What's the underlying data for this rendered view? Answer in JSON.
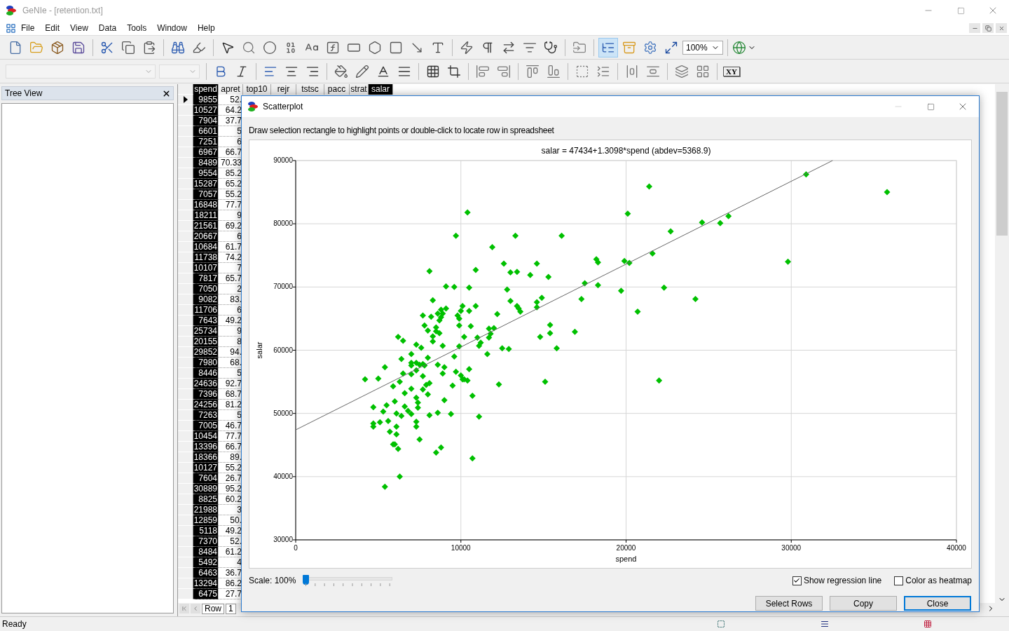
{
  "window": {
    "title": "GeNIe - [retention.txt]"
  },
  "menu": [
    "File",
    "Edit",
    "View",
    "Data",
    "Tools",
    "Window",
    "Help"
  ],
  "toolbar": {
    "tree_toggle": {
      "selected": true
    },
    "zoom": "100%",
    "xy_label": "XY"
  },
  "tree_view": {
    "title": "Tree View"
  },
  "grid": {
    "columns": [
      {
        "name": "spend",
        "selected": true
      },
      {
        "name": "apret",
        "selected": false
      },
      {
        "name": "top10",
        "selected": false
      },
      {
        "name": "rejr",
        "selected": false
      },
      {
        "name": "tstsc",
        "selected": false
      },
      {
        "name": "pacc",
        "selected": false
      },
      {
        "name": "strat",
        "selected": false
      },
      {
        "name": "salar",
        "selected": true
      }
    ],
    "rows": [
      [
        "9855",
        "52."
      ],
      [
        "10527",
        "64.2"
      ],
      [
        "7904",
        "37.7"
      ],
      [
        "6601",
        "5"
      ],
      [
        "7251",
        "6"
      ],
      [
        "6967",
        "66.7"
      ],
      [
        "8489",
        "70.33"
      ],
      [
        "9554",
        "85.2"
      ],
      [
        "15287",
        "65.2"
      ],
      [
        "7057",
        "55.2"
      ],
      [
        "16848",
        "77.7"
      ],
      [
        "18211",
        "9"
      ],
      [
        "21561",
        "69.2"
      ],
      [
        "20667",
        "6"
      ],
      [
        "10684",
        "61.7"
      ],
      [
        "11738",
        "74.2"
      ],
      [
        "10107",
        "7"
      ],
      [
        "7817",
        "65.7"
      ],
      [
        "7050",
        "2"
      ],
      [
        "9082",
        "83."
      ],
      [
        "11706",
        "6"
      ],
      [
        "7643",
        "49.2"
      ],
      [
        "25734",
        "9"
      ],
      [
        "20155",
        "8"
      ],
      [
        "29852",
        "94."
      ],
      [
        "7980",
        "68."
      ],
      [
        "8446",
        "5"
      ],
      [
        "24636",
        "92.7"
      ],
      [
        "7396",
        "68.7"
      ],
      [
        "24256",
        "81.2"
      ],
      [
        "7263",
        "5"
      ],
      [
        "7005",
        "46.7"
      ],
      [
        "10454",
        "77.7"
      ],
      [
        "13396",
        "66.7"
      ],
      [
        "18366",
        "89."
      ],
      [
        "10127",
        "55.2"
      ],
      [
        "7604",
        "26.7"
      ],
      [
        "30889",
        "95.2"
      ],
      [
        "8825",
        "60.2"
      ],
      [
        "21988",
        "3"
      ],
      [
        "12859",
        "50."
      ],
      [
        "5118",
        "49.2"
      ],
      [
        "7370",
        "52."
      ],
      [
        "8484",
        "61.2"
      ],
      [
        "5492",
        "4"
      ],
      [
        "6463",
        "36.7"
      ],
      [
        "13294",
        "86.2"
      ],
      [
        "6475",
        "27.7"
      ]
    ],
    "nav_label": "Row",
    "nav_value": "1"
  },
  "dialog": {
    "title": "Scatterplot",
    "instruction": "Draw selection rectangle to highlight points or double-click to locate row in spreadsheet",
    "chart_data": {
      "type": "scatter",
      "title": "salar = 47434+1.3098*spend (abdev=5368.9)",
      "xlabel": "spend",
      "ylabel": "salar",
      "xlim": [
        0,
        40000
      ],
      "ylim": [
        30000,
        90000
      ],
      "xticks": [
        0,
        10000,
        20000,
        30000,
        40000
      ],
      "yticks": [
        30000,
        40000,
        50000,
        60000,
        70000,
        80000,
        90000
      ],
      "grid": true,
      "x": [
        30900,
        21400,
        10400,
        20100,
        26200,
        24600,
        25700,
        22700,
        9700,
        13300,
        16100,
        11900,
        21600,
        18200,
        18300,
        19900,
        20200,
        29800,
        12600,
        14600,
        8100,
        10900,
        13000,
        13400,
        14200,
        15300,
        17500,
        18300,
        9100,
        9600,
        10500,
        22300,
        12800,
        19700,
        8300,
        13000,
        14900,
        17300,
        24200,
        14600,
        14600,
        10900,
        13400,
        13500,
        13600,
        10100,
        9100,
        8800,
        10500,
        10000,
        20700,
        8600,
        8900,
        12200,
        7700,
        8200,
        9800,
        8800,
        9900,
        8700,
        15400,
        7800,
        9900,
        10600,
        8500,
        11700,
        12000,
        8000,
        8500,
        8700,
        16900,
        11800,
        15400,
        8300,
        6200,
        10200,
        14800,
        11000,
        11700,
        6500,
        8300,
        11200,
        7300,
        11100,
        8900,
        7600,
        9900,
        12500,
        12900,
        15800,
        11600,
        7000,
        9600,
        8000,
        6400,
        7000,
        7300,
        7500,
        7700,
        7800,
        7000,
        8600,
        5400,
        9000,
        10500,
        7300,
        9700,
        6500,
        8900,
        7000,
        7700,
        10000,
        10100,
        10200,
        10400,
        4200,
        5000,
        6300,
        15100,
        22000,
        8100,
        12300,
        7900,
        5900,
        9500,
        7000,
        7700,
        6600,
        8000,
        10700,
        7300,
        9000,
        6000,
        7400,
        5500,
        4700,
        6600,
        7400,
        6800,
        5300,
        6100,
        7000,
        6400,
        8100,
        8600,
        9400,
        11100,
        7300,
        4700,
        5100,
        5600,
        4700,
        6100,
        7300,
        5700,
        6100,
        7500,
        5900,
        6000,
        6200,
        8800,
        8500,
        10700,
        6300,
        5400,
        35800
      ],
      "series": [
        {
          "color": "#00c000",
          "values": [
            87800,
            85900,
            81800,
            81600,
            81200,
            80200,
            80100,
            78800,
            78100,
            78100,
            78100,
            76300,
            75300,
            74400,
            73900,
            74100,
            73800,
            74000,
            73700,
            73700,
            72500,
            72700,
            72300,
            72400,
            71900,
            71600,
            70600,
            70300,
            70100,
            70000,
            69900,
            69900,
            69600,
            69400,
            67900,
            67800,
            68300,
            68100,
            68100,
            67600,
            66800,
            67000,
            67000,
            66600,
            66100,
            67000,
            66600,
            66400,
            66200,
            66200,
            66100,
            65800,
            65800,
            65700,
            65500,
            65300,
            65500,
            65200,
            65000,
            64700,
            64000,
            63900,
            63900,
            63800,
            63600,
            63400,
            63500,
            63100,
            63000,
            62700,
            62900,
            62600,
            62700,
            62200,
            62100,
            62100,
            62100,
            62000,
            62000,
            61500,
            61400,
            61200,
            60900,
            60700,
            60700,
            60400,
            60600,
            60300,
            60200,
            60300,
            59400,
            59400,
            59000,
            58800,
            58600,
            58000,
            58000,
            57700,
            57800,
            57600,
            57600,
            57700,
            57300,
            57300,
            57000,
            56800,
            56600,
            56300,
            56300,
            56200,
            55900,
            56000,
            55400,
            55400,
            55200,
            55400,
            55500,
            55000,
            55000,
            55200,
            54800,
            54600,
            54500,
            54300,
            54400,
            53900,
            53800,
            53200,
            53000,
            52800,
            52500,
            52100,
            51900,
            51700,
            51300,
            51000,
            51100,
            50900,
            50400,
            50300,
            50000,
            49900,
            49600,
            49700,
            50100,
            49900,
            49500,
            48700,
            48400,
            48600,
            48800,
            47900,
            47900,
            47900,
            47100,
            46700,
            45900,
            45100,
            45100,
            44400,
            44600,
            43800,
            42900,
            40000,
            38400,
            85000
          ]
        },
        {
          "type": "line",
          "color": "#666666",
          "x": [
            0,
            32500
          ],
          "values": [
            47400,
            90000
          ]
        }
      ]
    },
    "scale": {
      "label": "Scale: 100%",
      "level": 0
    },
    "checkboxes": [
      {
        "label": "Show regression line",
        "checked": true
      },
      {
        "label": "Color as heatmap",
        "checked": false
      }
    ],
    "buttons": [
      {
        "label": "Select Rows",
        "default": false
      },
      {
        "label": "Copy",
        "default": false
      },
      {
        "label": "Close",
        "default": true
      }
    ]
  },
  "status_bar": {
    "text": "Ready"
  }
}
